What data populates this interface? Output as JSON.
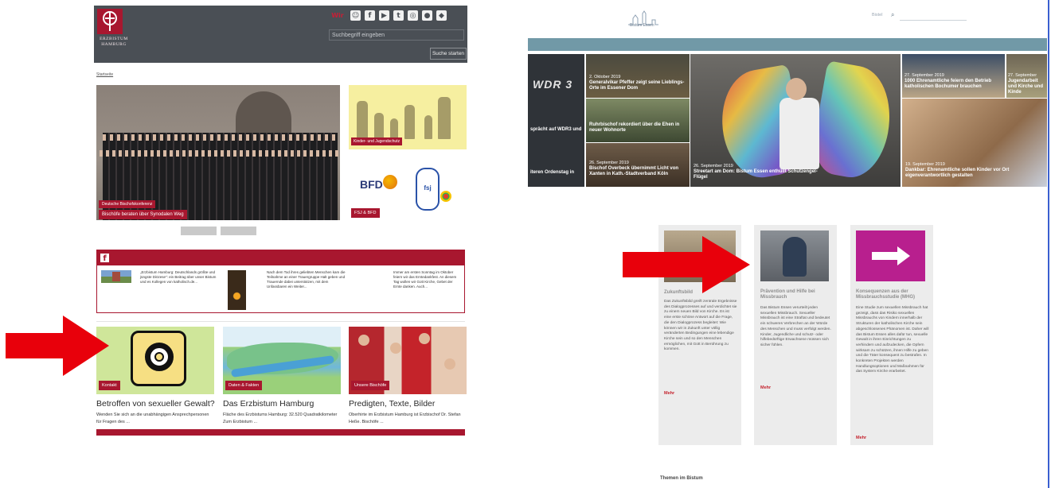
{
  "left_site": {
    "logo_text_line1": "ERZBISTUM",
    "logo_text_line2": "HAMBURG",
    "social_label": "Wir",
    "social_icons": [
      "group-icon",
      "facebook-icon",
      "youtube-icon",
      "twitter-icon",
      "instagram-icon",
      "apple-icon",
      "android-icon"
    ],
    "search_placeholder": "Suchbegriff eingeben",
    "search_button": "Suche starten",
    "breadcrumb": "Startseite",
    "hero": {
      "tag_small": "Deutsche Bischofskonferenz",
      "tag_title": "Bischöfe beraten über Synodalen Weg"
    },
    "side_cards": [
      {
        "tag": "Kinder- und Jugendschutz"
      },
      {
        "tag": "FSJ & BFD",
        "logo_bfd": "BFD",
        "logo_fsj": "fsj"
      }
    ],
    "facebook_posts": [
      "„Erzbistum Hamburg: Deutschlands größte und jüngste Diözese\": ein Beitrag über unser Bistum und es Kollegen von katholisch.de...",
      "Nach dem Tod ihres geliebten Menschen kam die Teilnahme an einer Trauergruppe Halt geben und Trauernde dabei unterstützen, mit dem Unfassbaren ein Weiter...",
      "Immer am ersten Sonntag im Oktober feiern wir das Erntedankfest. An diesem Tag wollen wir Gott Kirche, Gebet der Ernte danken. Auch..."
    ],
    "tiles": [
      {
        "tag": "Kontakt",
        "title": "Betroffen von sexueller Gewalt?",
        "text": "Wenden Sie sich an die unabhängigen Ansprechpersonen für Fragen des ..."
      },
      {
        "tag": "Daten & Fakten",
        "title": "Das Erzbistum Hamburg",
        "text": "Fläche des Erzbistums Hamburg: 32.520 Quadratkilometer Zum Erzbistum ..."
      },
      {
        "tag": "Unsere Bischöfe",
        "title": "Predigten, Texte, Bilder",
        "text": "Oberhirte im Erzbistum Hamburg ist Erzbischof Dr. Stefan Heße. Bischöfe ..."
      }
    ]
  },
  "right_site": {
    "logo_text": "Bistum Essen",
    "topnav": "Bistel",
    "search_icon": "search-icon",
    "grid_captions": [
      {
        "title": "sprächt auf WDR3 und",
        "date": ""
      },
      {
        "title": "Generalvikar Pfeffer zeigt seine Lieblings-Orte im Essener Dom",
        "date": "2. Oktober 2019"
      },
      {
        "title": "Ruhrbischof rekordiert über die Ehen in neuer Wohnorte",
        "date": ""
      },
      {
        "title": "Streetart am Dom: Bistum Essen enthüllt Schutzengel-Flügel",
        "date": "26. September 2019"
      },
      {
        "title": "1000 Ehrenamtliche feiern den Betrieb katholischen Bochumer brauchen",
        "date": "27. September 2019"
      },
      {
        "title": "Jugendarbeit und Kirche und Kinde",
        "date": "27. September"
      },
      {
        "title": "Bischof Overbeck übernimmt Licht von Xanten in Kath.-Stadtverband Köln",
        "date": "26. September 2019"
      },
      {
        "title": "Dankbar: Ehrenamtliche sollen Kinder vor Ort eigenverantwortlich gestalten",
        "date": "19. September 2019"
      },
      {
        "title": "iteren Ordenstag in",
        "date": ""
      }
    ],
    "cards": [
      {
        "title": "Zukunftsbild",
        "text": "Das Zukunftsbild greift zentrale Ergebnisse des Dialogprozesses auf und verdichtet sie zu einem neuen Bild von Kirche. Es ist eine erste schöne Antwort auf die Frage, die den Dialogprozess begleitet: Wie können wir in Zukunft unter völlig veränderten Bedingungen eine lebendige Kirche sein und so den Menschen ermöglichen, mit Gott in Berührung zu kommen.",
        "more": "Mehr"
      },
      {
        "title": "Prävention und Hilfe bei Missbrauch",
        "text": "Das Bistum Essen verurteilt jeden sexuellen Missbrauch. Sexueller Missbrauch ist eine Straftat und bedeutet ein schweres Verbrechen an der Würde des Menschen und muss verfolgt werden. Kinder, Jugendliche und schutz- oder hilfebedürftige Erwachsene müssen sich sicher fühlen.",
        "more": "Mehr"
      },
      {
        "title": "Konsequenzen aus der Missbrauchsstudie (MHG)",
        "text": "Eine Studie zum sexuellen Missbrauch hat gezeigt, dass das Risiko sexuellen Missbrauchs von Kindern innerhalb der Strukturen der katholischen Kirche sein abgeschlossenes Phänomen ist. Daher will das Bistum Essen alles dafür tun, sexuelle Gewalt in ihren Einrichtungen zu verhindern und aufzudecken, die Opfern wirksam zu schützen, ihnen Hilfe zu geben und die Täter konsequent zu bestrafen. In konkreten Projekten werden Handlungsoptionen und Maßnahmen für das System Kirche erarbeitet.",
        "more": "Mehr"
      }
    ],
    "section_heading": "Themen im Bistum"
  },
  "colors": {
    "erzbistum_red": "#a8172f",
    "header_gray": "#4a4f55",
    "essen_bar": "#7199a7",
    "highlight_arrow": "#e8000b",
    "divider_blue": "#3a5fd0"
  }
}
